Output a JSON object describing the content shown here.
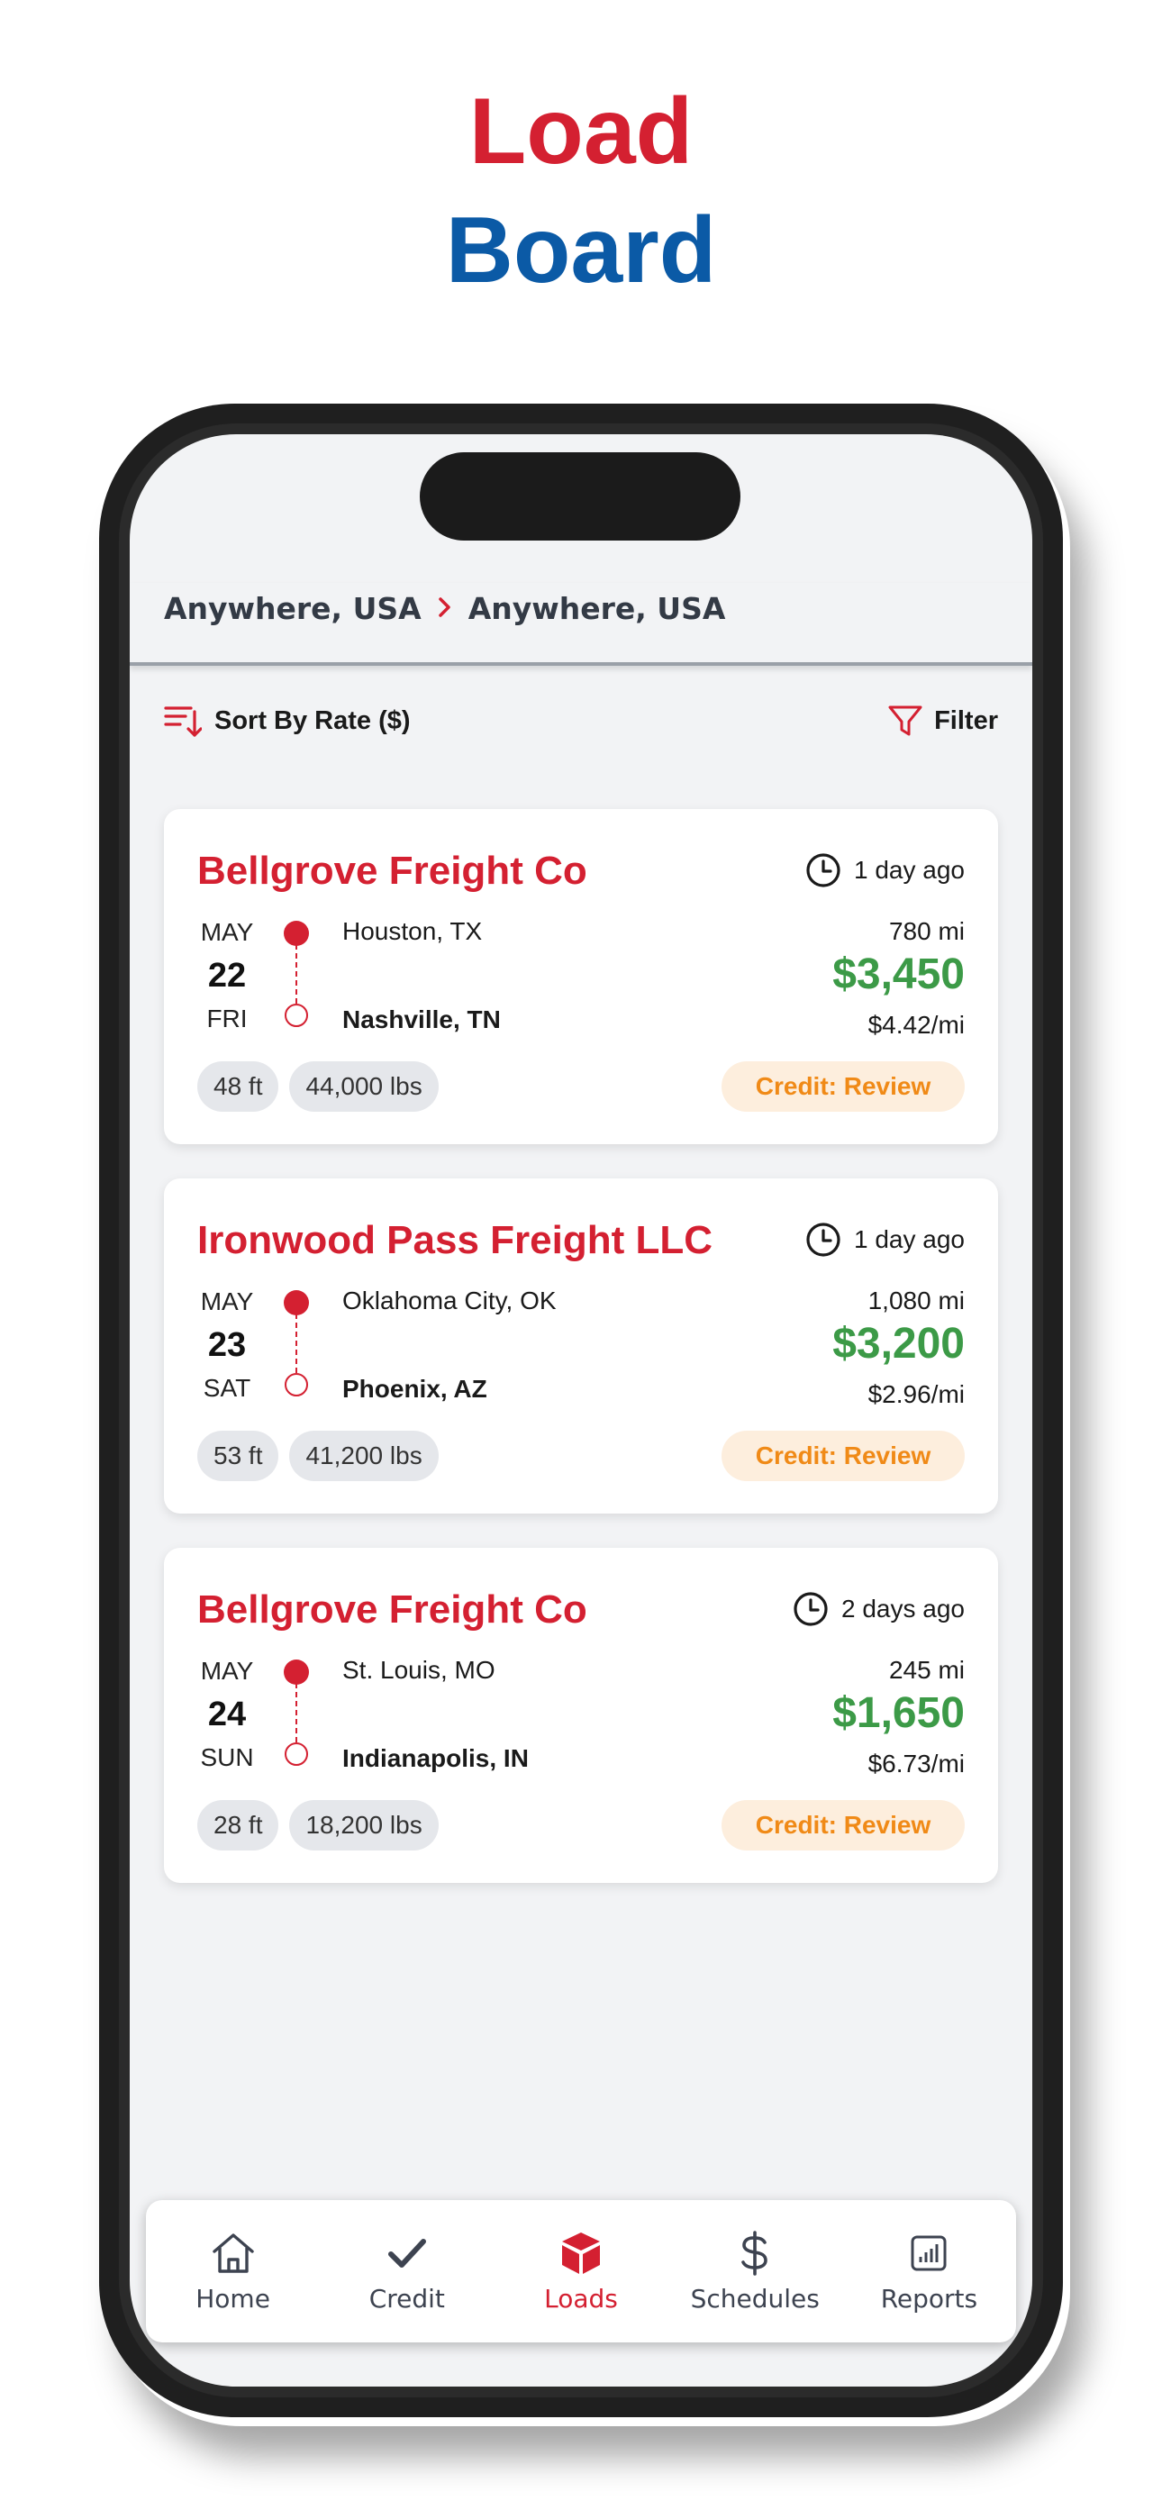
{
  "headline": {
    "line1": "Load",
    "line2": "Board"
  },
  "route": {
    "origin": "Anywhere, USA",
    "destination": "Anywhere, USA"
  },
  "toolbar": {
    "sort_label": "Sort By Rate ($)",
    "filter_label": "Filter"
  },
  "loads": [
    {
      "carrier": "Bellgrove Freight Co",
      "posted": "1 day ago",
      "month": "MAY",
      "day": "22",
      "dow": "FRI",
      "origin": "Houston, TX",
      "destination": "Nashville, TN",
      "miles": "780 mi",
      "rate": "$3,450",
      "rate_per_mile": "$4.42/mi",
      "length": "48 ft",
      "weight": "44,000 lbs",
      "credit": "Credit: Review"
    },
    {
      "carrier": "Ironwood Pass Freight LLC",
      "posted": "1 day ago",
      "month": "MAY",
      "day": "23",
      "dow": "SAT",
      "origin": "Oklahoma City, OK",
      "destination": "Phoenix, AZ",
      "miles": "1,080 mi",
      "rate": "$3,200",
      "rate_per_mile": "$2.96/mi",
      "length": "53 ft",
      "weight": "41,200 lbs",
      "credit": "Credit: Review"
    },
    {
      "carrier": "Bellgrove Freight Co",
      "posted": "2 days ago",
      "month": "MAY",
      "day": "24",
      "dow": "SUN",
      "origin": "St. Louis, MO",
      "destination": "Indianapolis, IN",
      "miles": "245 mi",
      "rate": "$1,650",
      "rate_per_mile": "$6.73/mi",
      "length": "28 ft",
      "weight": "18,200 lbs",
      "credit": "Credit: Review"
    }
  ],
  "nav": [
    {
      "label": "Home",
      "icon": "home-icon"
    },
    {
      "label": "Credit",
      "icon": "check-icon"
    },
    {
      "label": "Loads",
      "icon": "box-icon",
      "active": true
    },
    {
      "label": "Schedules",
      "icon": "dollar-icon"
    },
    {
      "label": "Reports",
      "icon": "chart-icon"
    }
  ],
  "colors": {
    "brand_red": "#d42031",
    "brand_blue": "#0b5aa6",
    "rate_green": "#3c9a47",
    "credit_orange": "#f08a17"
  }
}
